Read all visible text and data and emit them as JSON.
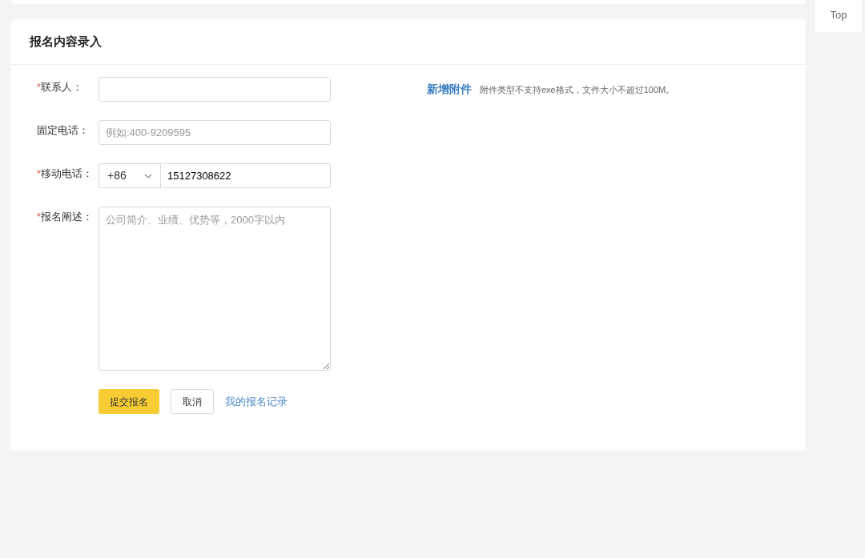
{
  "back_to_top": {
    "label": "Top"
  },
  "form": {
    "title": "报名内容录入",
    "fields": [
      {
        "kind": "text",
        "required_mark": "*",
        "label": "联系人："
      },
      {
        "kind": "text",
        "label": "固定电话：",
        "placeholder": "例如:400-9209595"
      },
      {
        "kind": "phone",
        "required_mark": "*",
        "label": "移动电话：",
        "country_code": "+86",
        "value": "15127308622"
      },
      {
        "kind": "textarea",
        "required_mark": "*",
        "label": "报名阐述：",
        "placeholder": "公司简介、业绩、优势等，2000字以内"
      }
    ],
    "attachment": {
      "link": "新增附件",
      "hint": "附件类型不支持exe格式，文件大小不超过100M。"
    },
    "buttons": [
      {
        "kind": "primary",
        "label": "提交报名"
      },
      {
        "kind": "secondary",
        "label": "取消"
      },
      {
        "kind": "link",
        "label": "我的报名记录"
      }
    ]
  }
}
